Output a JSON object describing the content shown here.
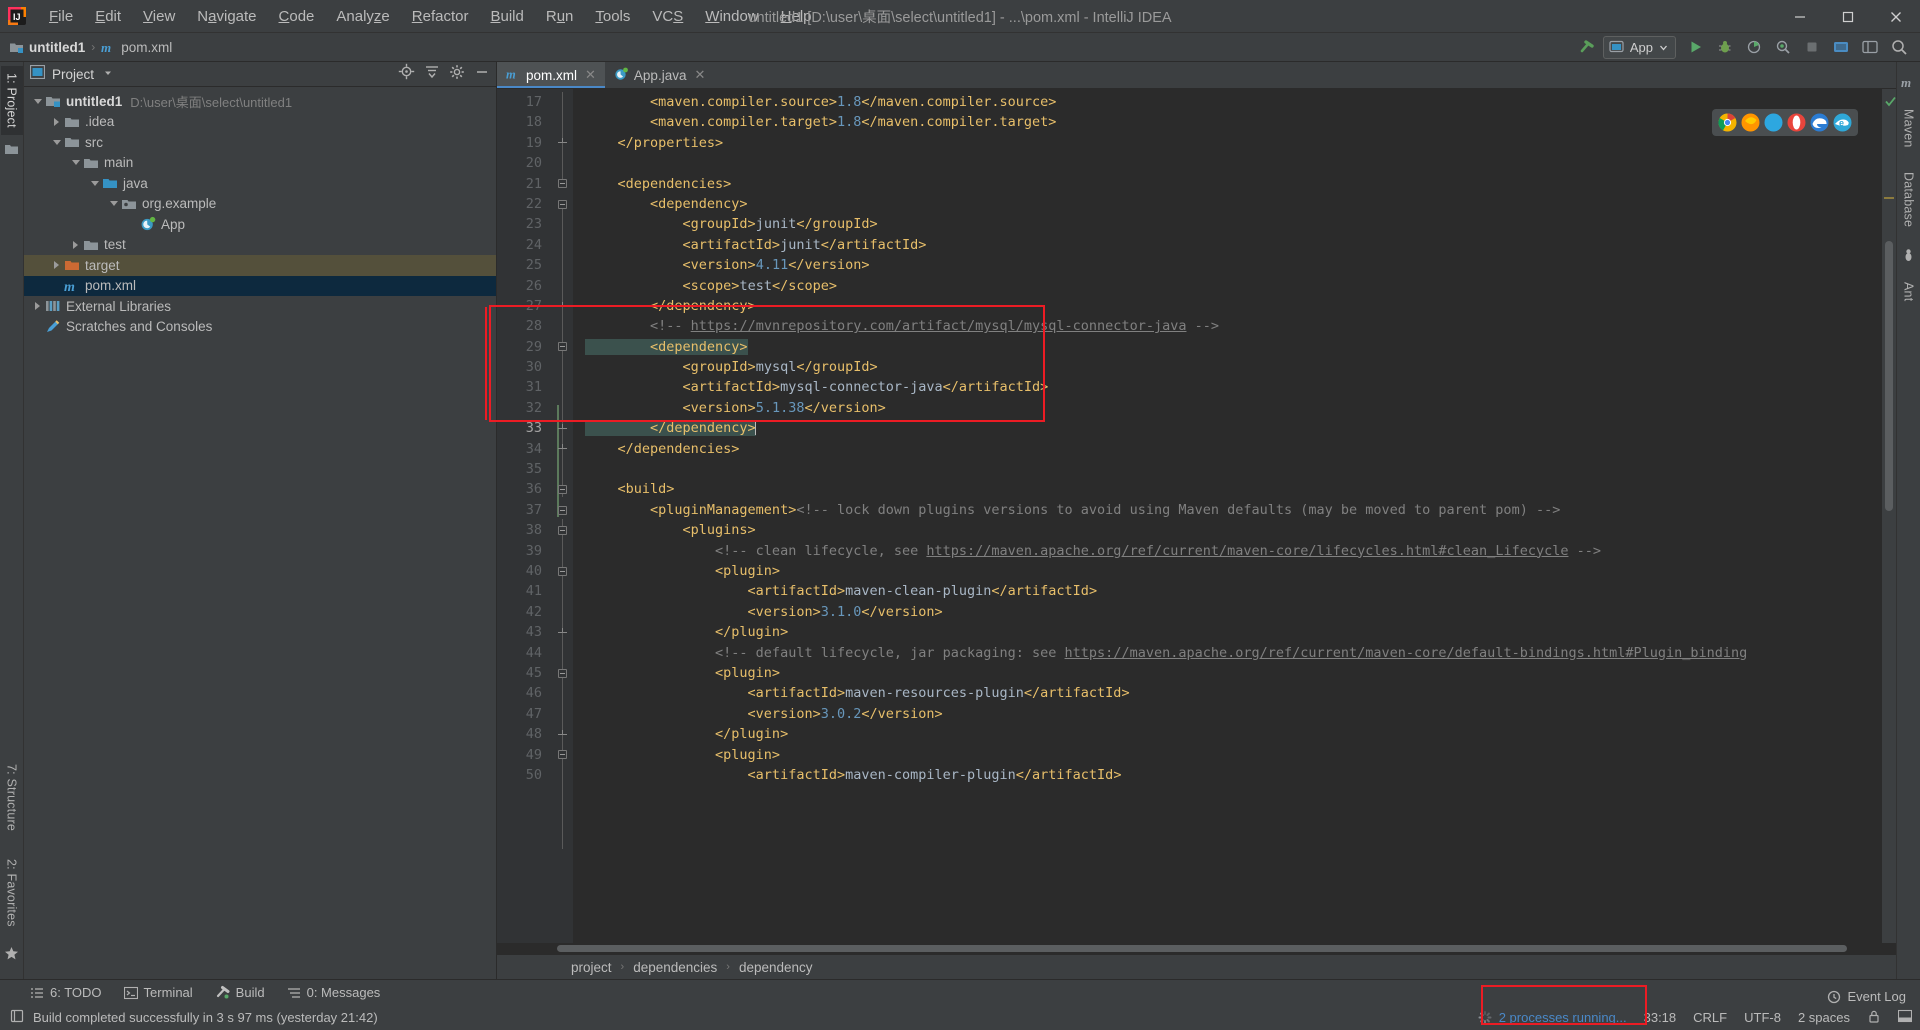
{
  "window": {
    "title": "untitled1 [D:\\user\\桌面\\select\\untitled1] - ...\\pom.xml - IntelliJ IDEA",
    "minimize": "—",
    "maximize": "▭",
    "close": "✕"
  },
  "menu": {
    "items": [
      "File",
      "Edit",
      "View",
      "Navigate",
      "Code",
      "Analyze",
      "Refactor",
      "Build",
      "Run",
      "Tools",
      "VCS",
      "Window",
      "Help"
    ]
  },
  "navbar": {
    "crumbs": [
      "untitled1",
      "pom.xml"
    ],
    "run_config": "App",
    "separator": "›"
  },
  "left_rail": {
    "project_tab": "1: Project",
    "structure_tab": "7: Structure",
    "favorites_tab": "2: Favorites"
  },
  "right_rail": {
    "maven_tab": "Maven",
    "database_tab": "Database",
    "ant_tab": "Ant"
  },
  "project_panel": {
    "title": "Project",
    "tree": [
      {
        "label": "untitled1",
        "path": "D:\\user\\桌面\\select\\untitled1",
        "icon": "module-icon",
        "arrow": "down",
        "indent": 0,
        "bold": true,
        "state": "normal"
      },
      {
        "label": ".idea",
        "path": "",
        "icon": "folder-gray-icon",
        "arrow": "right",
        "indent": 1,
        "bold": false,
        "state": "normal"
      },
      {
        "label": "src",
        "path": "",
        "icon": "folder-gray-icon",
        "arrow": "down",
        "indent": 1,
        "bold": false,
        "state": "normal"
      },
      {
        "label": "main",
        "path": "",
        "icon": "folder-gray-icon",
        "arrow": "down",
        "indent": 2,
        "bold": false,
        "state": "normal"
      },
      {
        "label": "java",
        "path": "",
        "icon": "folder-blue-icon",
        "arrow": "down",
        "indent": 3,
        "bold": false,
        "state": "normal"
      },
      {
        "label": "org.example",
        "path": "",
        "icon": "package-icon",
        "arrow": "down",
        "indent": 4,
        "bold": false,
        "state": "normal"
      },
      {
        "label": "App",
        "path": "",
        "icon": "java-class-icon",
        "arrow": "none",
        "indent": 5,
        "bold": false,
        "state": "normal"
      },
      {
        "label": "test",
        "path": "",
        "icon": "folder-gray-icon",
        "arrow": "right",
        "indent": 2,
        "bold": false,
        "state": "normal"
      },
      {
        "label": "target",
        "path": "",
        "icon": "folder-orange-icon",
        "arrow": "right",
        "indent": 1,
        "bold": false,
        "state": "highlight"
      },
      {
        "label": "pom.xml",
        "path": "",
        "icon": "maven-icon",
        "arrow": "none",
        "indent": 1,
        "bold": false,
        "state": "selected"
      },
      {
        "label": "External Libraries",
        "path": "",
        "icon": "libraries-icon",
        "arrow": "right",
        "indent": 0,
        "bold": false,
        "state": "normal"
      },
      {
        "label": "Scratches and Consoles",
        "path": "",
        "icon": "scratches-icon",
        "arrow": "none",
        "indent": 0,
        "bold": false,
        "state": "normal"
      }
    ]
  },
  "editor": {
    "tabs": [
      {
        "label": "pom.xml",
        "icon": "maven-icon",
        "active": true,
        "close": "✕"
      },
      {
        "label": "App.java",
        "icon": "java-class-icon",
        "active": false,
        "close": "✕"
      }
    ],
    "first_line_number": 17,
    "current_line": 33,
    "lines": [
      {
        "n": 17,
        "fold": "none",
        "segs": [
          {
            "t": "tag",
            "s": "        <maven.compiler.source>"
          },
          {
            "t": "num",
            "s": "1.8"
          },
          {
            "t": "tag",
            "s": "</maven.compiler.source>"
          }
        ]
      },
      {
        "n": 18,
        "fold": "none",
        "segs": [
          {
            "t": "tag",
            "s": "        <maven.compiler.target>"
          },
          {
            "t": "num",
            "s": "1.8"
          },
          {
            "t": "tag",
            "s": "</maven.compiler.target>"
          }
        ]
      },
      {
        "n": 19,
        "fold": "end",
        "segs": [
          {
            "t": "tag",
            "s": "    </properties>"
          }
        ]
      },
      {
        "n": 20,
        "fold": "none",
        "segs": [
          {
            "t": "val",
            "s": ""
          }
        ]
      },
      {
        "n": 21,
        "fold": "box",
        "segs": [
          {
            "t": "tag",
            "s": "    <dependencies>"
          }
        ]
      },
      {
        "n": 22,
        "fold": "box",
        "segs": [
          {
            "t": "tag",
            "s": "        <dependency>"
          }
        ]
      },
      {
        "n": 23,
        "fold": "none",
        "segs": [
          {
            "t": "tag",
            "s": "            <groupId>"
          },
          {
            "t": "val",
            "s": "junit"
          },
          {
            "t": "tag",
            "s": "</groupId>"
          }
        ]
      },
      {
        "n": 24,
        "fold": "none",
        "segs": [
          {
            "t": "tag",
            "s": "            <artifactId>"
          },
          {
            "t": "val",
            "s": "junit"
          },
          {
            "t": "tag",
            "s": "</artifactId>"
          }
        ]
      },
      {
        "n": 25,
        "fold": "none",
        "segs": [
          {
            "t": "tag",
            "s": "            <version>"
          },
          {
            "t": "num",
            "s": "4.11"
          },
          {
            "t": "tag",
            "s": "</version>"
          }
        ]
      },
      {
        "n": 26,
        "fold": "none",
        "segs": [
          {
            "t": "tag",
            "s": "            <scope>"
          },
          {
            "t": "val",
            "s": "test"
          },
          {
            "t": "tag",
            "s": "</scope>"
          }
        ]
      },
      {
        "n": 27,
        "fold": "end",
        "segs": [
          {
            "t": "tag",
            "s": "        </dependency>"
          }
        ]
      },
      {
        "n": 28,
        "fold": "none",
        "segs": [
          {
            "t": "cmt",
            "s": "        <!-- "
          },
          {
            "t": "lnk",
            "s": "https://mvnrepository.com/artifact/mysql/mysql-connector-java"
          },
          {
            "t": "cmt",
            "s": " -->"
          }
        ]
      },
      {
        "n": 29,
        "fold": "box",
        "segs": [
          {
            "t": "hl-tag",
            "s": "        <dependency>"
          }
        ]
      },
      {
        "n": 30,
        "fold": "none",
        "segs": [
          {
            "t": "tag",
            "s": "            <groupId>"
          },
          {
            "t": "val",
            "s": "mysql"
          },
          {
            "t": "tag",
            "s": "</groupId>"
          }
        ]
      },
      {
        "n": 31,
        "fold": "none",
        "segs": [
          {
            "t": "tag",
            "s": "            <artifactId>"
          },
          {
            "t": "val",
            "s": "mysql-connector-java"
          },
          {
            "t": "tag",
            "s": "</artifactId>"
          }
        ]
      },
      {
        "n": 32,
        "fold": "none",
        "segs": [
          {
            "t": "tag",
            "s": "            <version>"
          },
          {
            "t": "num",
            "s": "5.1.38"
          },
          {
            "t": "tag",
            "s": "</version>"
          }
        ]
      },
      {
        "n": 33,
        "fold": "end",
        "segs": [
          {
            "t": "hl-tag",
            "s": "        </dependency>"
          },
          {
            "t": "caret",
            "s": ""
          }
        ]
      },
      {
        "n": 34,
        "fold": "end",
        "segs": [
          {
            "t": "tag",
            "s": "    </dependencies>"
          }
        ]
      },
      {
        "n": 35,
        "fold": "none",
        "segs": [
          {
            "t": "val",
            "s": ""
          }
        ]
      },
      {
        "n": 36,
        "fold": "box",
        "segs": [
          {
            "t": "tag",
            "s": "    <build>"
          }
        ]
      },
      {
        "n": 37,
        "fold": "box",
        "segs": [
          {
            "t": "tag",
            "s": "        <pluginManagement>"
          },
          {
            "t": "cmt",
            "s": "<!-- lock down plugins versions to avoid using Maven defaults (may be moved to parent pom) -->"
          }
        ]
      },
      {
        "n": 38,
        "fold": "box",
        "segs": [
          {
            "t": "tag",
            "s": "            <plugins>"
          }
        ]
      },
      {
        "n": 39,
        "fold": "none",
        "segs": [
          {
            "t": "cmt",
            "s": "                <!-- clean lifecycle, see "
          },
          {
            "t": "lnk",
            "s": "https://maven.apache.org/ref/current/maven-core/lifecycles.html#clean_Lifecycle"
          },
          {
            "t": "cmt",
            "s": " -->"
          }
        ]
      },
      {
        "n": 40,
        "fold": "box",
        "segs": [
          {
            "t": "tag",
            "s": "                <plugin>"
          }
        ]
      },
      {
        "n": 41,
        "fold": "none",
        "segs": [
          {
            "t": "tag",
            "s": "                    <artifactId>"
          },
          {
            "t": "val",
            "s": "maven-clean-plugin"
          },
          {
            "t": "tag",
            "s": "</artifactId>"
          }
        ]
      },
      {
        "n": 42,
        "fold": "none",
        "segs": [
          {
            "t": "tag",
            "s": "                    <version>"
          },
          {
            "t": "num",
            "s": "3.1.0"
          },
          {
            "t": "tag",
            "s": "</version>"
          }
        ]
      },
      {
        "n": 43,
        "fold": "end",
        "segs": [
          {
            "t": "tag",
            "s": "                </plugin>"
          }
        ]
      },
      {
        "n": 44,
        "fold": "none",
        "segs": [
          {
            "t": "cmt",
            "s": "                <!-- default lifecycle, jar packaging: see "
          },
          {
            "t": "lnk",
            "s": "https://maven.apache.org/ref/current/maven-core/default-bindings.html#Plugin_binding"
          }
        ]
      },
      {
        "n": 45,
        "fold": "box",
        "segs": [
          {
            "t": "tag",
            "s": "                <plugin>"
          }
        ]
      },
      {
        "n": 46,
        "fold": "none",
        "segs": [
          {
            "t": "tag",
            "s": "                    <artifactId>"
          },
          {
            "t": "val",
            "s": "maven-resources-plugin"
          },
          {
            "t": "tag",
            "s": "</artifactId>"
          }
        ]
      },
      {
        "n": 47,
        "fold": "none",
        "segs": [
          {
            "t": "tag",
            "s": "                    <version>"
          },
          {
            "t": "num",
            "s": "3.0.2"
          },
          {
            "t": "tag",
            "s": "</version>"
          }
        ]
      },
      {
        "n": 48,
        "fold": "end",
        "segs": [
          {
            "t": "tag",
            "s": "                </plugin>"
          }
        ]
      },
      {
        "n": 49,
        "fold": "box",
        "segs": [
          {
            "t": "tag",
            "s": "                <plugin>"
          }
        ]
      },
      {
        "n": 50,
        "fold": "none",
        "segs": [
          {
            "t": "tag",
            "s": "                    <artifactId>"
          },
          {
            "t": "val",
            "s": "maven-compiler-plugin"
          },
          {
            "t": "tag",
            "s": "</artifactId>"
          }
        ]
      }
    ],
    "breadcrumb": [
      "project",
      "dependencies",
      "dependency"
    ],
    "breadcrumb_separator": "›"
  },
  "bottom_tools": [
    {
      "label": "6: TODO",
      "icon": "todo-icon",
      "mnemonic": "6"
    },
    {
      "label": "Terminal",
      "icon": "terminal-icon",
      "mnemonic": ""
    },
    {
      "label": "Build",
      "icon": "build-hammer-icon",
      "mnemonic": ""
    },
    {
      "label": "0: Messages",
      "icon": "messages-icon",
      "mnemonic": "0"
    }
  ],
  "status": {
    "message": "Build completed successfully in 3 s 97 ms (yesterday 21:42)",
    "processes": "2 processes running...",
    "caret_position": "33:18",
    "line_separator": "CRLF",
    "encoding": "UTF-8",
    "indent": "2 spaces",
    "event_log": "Event Log"
  },
  "colors": {
    "accent_blue": "#4a88c7",
    "red_highlight": "#ec1c24",
    "selection_blue": "#0d293e",
    "target_highlight": "#54503b",
    "tag_yellow": "#e8bf6a",
    "number_blue": "#6897bb",
    "comment_gray": "#808080",
    "editor_bg": "#2b2b2b",
    "panel_bg": "#3c3f41"
  }
}
